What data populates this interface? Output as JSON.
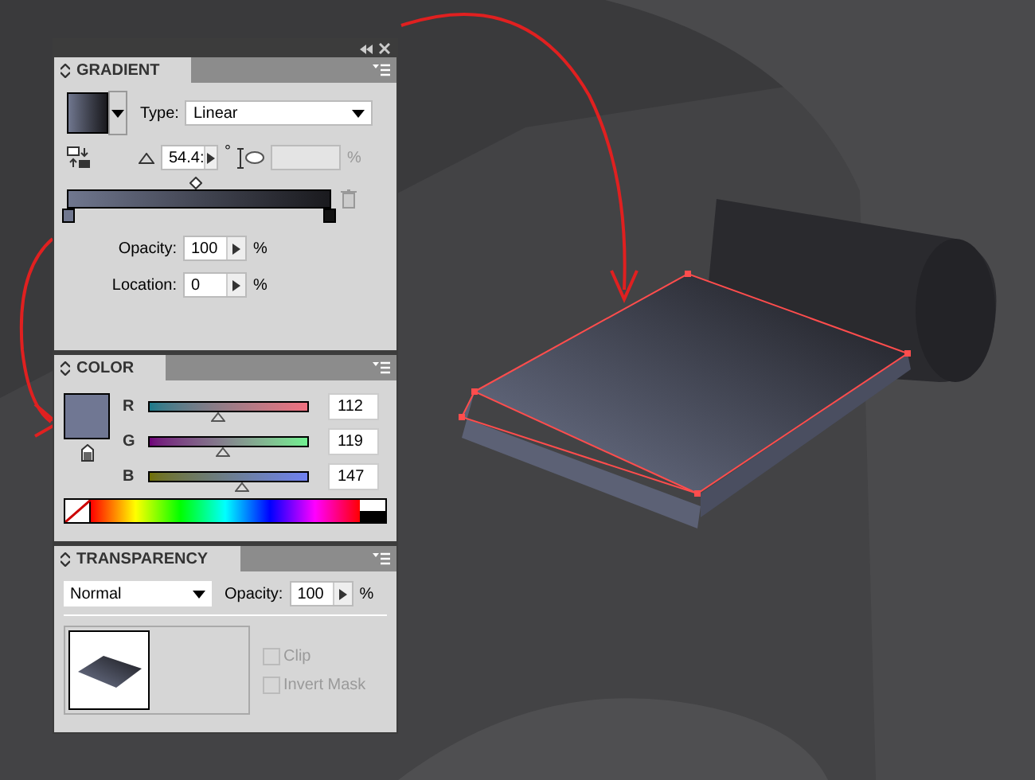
{
  "gradient": {
    "title": "GRADIENT",
    "type_label": "Type:",
    "type_value": "Linear",
    "angle": "54.4:",
    "angle_unit": "°",
    "aspect_unit": "%",
    "midpoint": {
      "level": 0.49
    },
    "opacity_label": "Opacity:",
    "opacity": "100",
    "opacity_unit": "%",
    "location_label": "Location:",
    "location": "0",
    "location_unit": "%"
  },
  "color": {
    "title": "COLOR",
    "channels": [
      {
        "name": "R",
        "value": "112",
        "level": 0.44
      },
      {
        "name": "G",
        "value": "119",
        "level": 0.47
      },
      {
        "name": "B",
        "value": "147",
        "level": 0.58
      }
    ]
  },
  "transparency": {
    "title": "TRANSPARENCY",
    "blend_mode": "Normal",
    "opacity_label": "Opacity:",
    "opacity": "100",
    "opacity_unit": "%",
    "options": [
      {
        "label": "Clip",
        "checked": false,
        "disabled": true
      },
      {
        "label": "Invert Mask",
        "checked": false,
        "disabled": true
      }
    ]
  }
}
